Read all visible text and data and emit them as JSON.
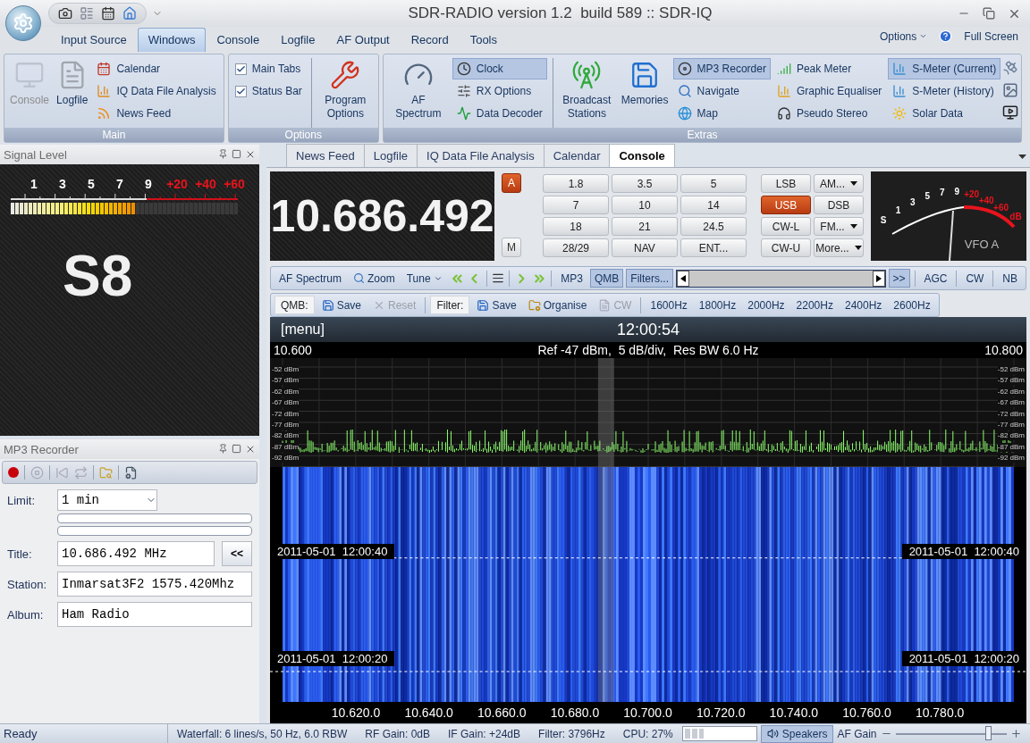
{
  "window": {
    "title": "SDR-RADIO version 1.2  build 589 :: SDR-IQ"
  },
  "menu": {
    "tabs": [
      {
        "label": "Input Source",
        "selected": false
      },
      {
        "label": "Windows",
        "selected": true
      },
      {
        "label": "Console",
        "selected": false
      },
      {
        "label": "Logfile",
        "selected": false
      },
      {
        "label": "AF Output",
        "selected": false
      },
      {
        "label": "Record",
        "selected": false
      },
      {
        "label": "Tools",
        "selected": false
      }
    ],
    "options": "Options",
    "full_screen": "Full Screen"
  },
  "ribbon": [
    {
      "title": "Main",
      "items": [
        {
          "kind": "large",
          "label": "Console",
          "disabled": true
        },
        {
          "kind": "large",
          "label": "Logfile",
          "disabled": false
        },
        {
          "kind": "list",
          "entries": [
            {
              "label": "Calendar",
              "active": false
            },
            {
              "label": "IQ Data File Analysis",
              "active": false
            },
            {
              "label": "News Feed",
              "active": false
            }
          ]
        }
      ]
    },
    {
      "title": "Options",
      "items": [
        {
          "kind": "checks",
          "entries": [
            {
              "label": "Main Tabs",
              "checked": true
            },
            {
              "label": "Status Bar",
              "checked": true
            }
          ]
        },
        {
          "kind": "large",
          "label": "Program Options",
          "disabled": false
        }
      ]
    },
    {
      "title": "Extras",
      "items": [
        {
          "kind": "large",
          "label": "AF Spectrum",
          "disabled": false
        },
        {
          "kind": "list",
          "entries": [
            {
              "label": "Clock",
              "active": true
            },
            {
              "label": "RX Options",
              "active": false
            },
            {
              "label": "Data Decoder",
              "active": false
            }
          ]
        },
        {
          "kind": "large",
          "label": "Broadcast Stations",
          "disabled": false
        },
        {
          "kind": "large",
          "label": "Memories",
          "disabled": false
        },
        {
          "kind": "list",
          "entries": [
            {
              "label": "MP3 Recorder",
              "active": true
            },
            {
              "label": "Navigate",
              "active": false
            },
            {
              "label": "Map",
              "active": false
            }
          ]
        },
        {
          "kind": "list",
          "entries": [
            {
              "label": "Peak Meter",
              "active": false
            },
            {
              "label": "Graphic Equaliser",
              "active": false
            },
            {
              "label": "Pseudo Stereo",
              "active": false
            }
          ]
        },
        {
          "kind": "list",
          "entries": [
            {
              "label": "S-Meter (Current)",
              "active": true
            },
            {
              "label": "S-Meter (History)",
              "active": false
            },
            {
              "label": "Solar Data",
              "active": false
            }
          ]
        }
      ]
    }
  ],
  "signal_level": {
    "title": "Signal Level",
    "scale": [
      {
        "label": "1",
        "color": "#ffffff"
      },
      {
        "label": "3",
        "color": "#ffffff"
      },
      {
        "label": "5",
        "color": "#ffffff"
      },
      {
        "label": "7",
        "color": "#ffffff"
      },
      {
        "label": "9",
        "color": "#ffffff"
      },
      {
        "label": "+20",
        "color": "#e8141c"
      },
      {
        "label": "+40",
        "color": "#e8141c"
      },
      {
        "label": "+60",
        "color": "#e8141c"
      }
    ],
    "level": 0.55,
    "reading": "S8"
  },
  "mp3_recorder": {
    "title": "MP3 Recorder",
    "limit_label": "Limit:",
    "limit": "1 min",
    "progress": [
      {
        "level": 0
      },
      {
        "level": 0
      }
    ],
    "fields": [
      {
        "label": "Title:",
        "value": "10.686.492 MHz",
        "button": "<<"
      },
      {
        "label": "Station:",
        "value": "Inmarsat3F2 1575.420Mhz"
      },
      {
        "label": "Album:",
        "value": "Ham Radio"
      }
    ]
  },
  "console": {
    "tabs": [
      {
        "label": "News Feed",
        "selected": false
      },
      {
        "label": "Logfile",
        "selected": false
      },
      {
        "label": "IQ Data File Analysis",
        "selected": false
      },
      {
        "label": "Calendar",
        "selected": false
      },
      {
        "label": "Console",
        "selected": true
      }
    ],
    "frequency": "10.686.492",
    "vfo": [
      {
        "label": "A",
        "selected": true
      },
      {
        "label": "M",
        "selected": false
      }
    ],
    "bands": [
      "1.8",
      "3.5",
      "5",
      "7",
      "10",
      "14",
      "18",
      "21",
      "24.5",
      "28/29",
      "NAV",
      "ENT..."
    ],
    "modes": [
      {
        "label": "LSB",
        "selected": false,
        "dropdown": false
      },
      {
        "label": "AM...",
        "selected": false,
        "dropdown": true
      },
      {
        "label": "USB",
        "selected": true,
        "dropdown": false
      },
      {
        "label": "DSB",
        "selected": false,
        "dropdown": false
      },
      {
        "label": "CW-L",
        "selected": false,
        "dropdown": false
      },
      {
        "label": "FM...",
        "selected": false,
        "dropdown": true
      },
      {
        "label": "CW-U",
        "selected": false,
        "dropdown": false
      },
      {
        "label": "More...",
        "selected": false,
        "dropdown": true
      }
    ],
    "meter": {
      "scale": [
        {
          "label": "S",
          "color": "#ffffff"
        },
        {
          "label": "1",
          "color": "#ffffff"
        },
        {
          "label": "3",
          "color": "#ffffff"
        },
        {
          "label": "5",
          "color": "#ffffff"
        },
        {
          "label": "7",
          "color": "#ffffff"
        },
        {
          "label": "9",
          "color": "#ffffff"
        },
        {
          "label": "+20",
          "color": "#e8141c"
        },
        {
          "label": "+40",
          "color": "#e8141c"
        },
        {
          "label": "+60",
          "color": "#e8141c"
        },
        {
          "label": "dB",
          "color": "#e8141c"
        }
      ],
      "vfo": "VFO A"
    },
    "toolbar": [
      {
        "kind": "button",
        "label": "AF Spectrum",
        "active": false
      },
      {
        "kind": "icon-button",
        "label": "Zoom",
        "active": false
      },
      {
        "kind": "dropdown",
        "label": "Tune",
        "active": false
      },
      {
        "kind": "nav"
      },
      {
        "kind": "separator"
      },
      {
        "kind": "button",
        "label": "MP3",
        "active": false
      },
      {
        "kind": "button",
        "label": "QMB",
        "active": true
      },
      {
        "kind": "button",
        "label": "Filters...",
        "active": true
      },
      {
        "kind": "scroll"
      },
      {
        "kind": "button",
        "label": ">>",
        "active": true
      },
      {
        "kind": "separator"
      },
      {
        "kind": "button",
        "label": "AGC",
        "active": false
      },
      {
        "kind": "separator"
      },
      {
        "kind": "button",
        "label": "CW",
        "active": false
      },
      {
        "kind": "separator"
      },
      {
        "kind": "button",
        "label": "NB",
        "active": false
      }
    ],
    "toolbar_2": [
      {
        "kind": "caption",
        "label": "QMB:"
      },
      {
        "kind": "icon-button",
        "label": "Save",
        "disabled": false
      },
      {
        "kind": "icon-button",
        "label": "Reset",
        "disabled": true
      },
      {
        "kind": "separator"
      },
      {
        "kind": "caption",
        "label": "Filter:"
      },
      {
        "kind": "icon-button",
        "label": "Save",
        "disabled": false
      },
      {
        "kind": "icon-button",
        "label": "Organise",
        "disabled": false
      },
      {
        "kind": "icon-button",
        "label": "CW",
        "disabled": true
      },
      {
        "kind": "separator"
      },
      {
        "kind": "button",
        "label": "1600Hz",
        "disabled": false
      },
      {
        "kind": "button",
        "label": "1800Hz",
        "disabled": false
      },
      {
        "kind": "button",
        "label": "2000Hz",
        "disabled": false
      },
      {
        "kind": "button",
        "label": "2200Hz",
        "disabled": false
      },
      {
        "kind": "button",
        "label": "2400Hz",
        "disabled": false
      },
      {
        "kind": "button",
        "label": "2600Hz",
        "disabled": false
      }
    ],
    "spectrum": {
      "menu": "[menu]",
      "time": "12:00:54",
      "start": "10.600",
      "info": "Ref -47 dBm,  5 dB/div,  Res BW 6.0 Hz",
      "end": "10.800",
      "dbm_left": [
        "-52 dBm",
        "-57 dBm",
        "-62 dBm",
        "-67 dBm",
        "-72 dBm",
        "-77 dBm",
        "-82 dBm",
        "-87 dBm",
        "-92 dBm"
      ],
      "dbm_right": [
        "-52 dBm",
        "-57 dBm",
        "-62 dBm",
        "-67 dBm",
        "-72 dBm",
        "-77 dBm",
        "-82 dBm",
        "-87 dBm",
        "-92 dBm"
      ],
      "timestamps": [
        {
          "left": "2011-05-01  12:00:40",
          "right": "2011-05-01  12:00:40"
        },
        {
          "left": "2011-05-01  12:00:20",
          "right": "2011-05-01  12:00:20"
        }
      ],
      "axis": [
        "10.620.0",
        "10.640.0",
        "10.660.0",
        "10.680.0",
        "10.700.0",
        "10.720.0",
        "10.740.0",
        "10.760.0",
        "10.780.0"
      ]
    }
  },
  "status": {
    "ready": "Ready",
    "fields": [
      "Waterfall: 6 lines/s, 50 Hz, 6.0 RBW",
      "RF Gain: 0dB",
      "IF Gain: +24dB",
      "Filter: 3796Hz",
      "CPU: 27%"
    ],
    "cpu_meter": {
      "level": 0.27
    },
    "speakers": "Speakers",
    "af_gain": {
      "label": "AF Gain",
      "level": 0.84
    }
  }
}
